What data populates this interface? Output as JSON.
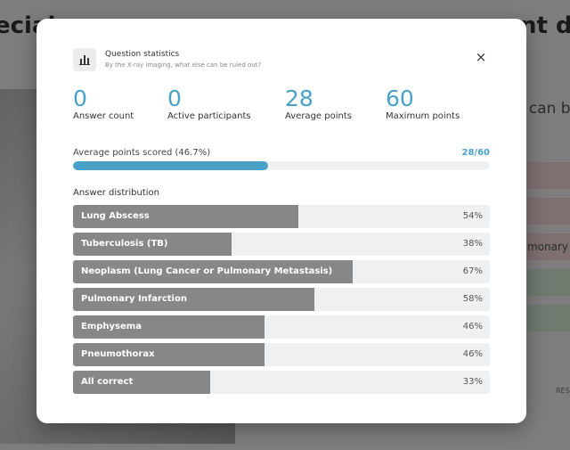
{
  "background": {
    "title_left": "ecial",
    "title_right": "nt d",
    "question_right": "e can b",
    "answer_fragment": "monary",
    "button_fragment": "RES",
    "answer_colors": [
      "#f3d6d6",
      "#f3d6d6",
      "#f3d6d6",
      "#d7ecd7",
      "#d7ecd7"
    ]
  },
  "modal": {
    "title": "Question statistics",
    "subtitle": "By the X-ray imaging, what else can be ruled out?",
    "close_label": "×",
    "icon": "bar-chart-icon",
    "accent_color": "#4aa1c8"
  },
  "stats": [
    {
      "value": "0",
      "label": "Answer count"
    },
    {
      "value": "0",
      "label": "Active participants"
    },
    {
      "value": "28",
      "label": "Average points"
    },
    {
      "value": "60",
      "label": "Maximum points"
    }
  ],
  "average": {
    "label": "Average points scored (46.7%)",
    "score": "28/60",
    "fraction": 0.467
  },
  "distribution": {
    "heading": "Answer distribution",
    "items": [
      {
        "label": "Lung Abscess",
        "percent": "54%",
        "value": 54
      },
      {
        "label": "Tuberculosis (TB)",
        "percent": "38%",
        "value": 38
      },
      {
        "label": "Neoplasm (Lung Cancer or Pulmonary Metastasis)",
        "percent": "67%",
        "value": 67
      },
      {
        "label": "Pulmonary Infarction",
        "percent": "58%",
        "value": 58
      },
      {
        "label": "Emphysema",
        "percent": "46%",
        "value": 46
      },
      {
        "label": "Pneumothorax",
        "percent": "46%",
        "value": 46
      },
      {
        "label": "All correct",
        "percent": "33%",
        "value": 33
      }
    ]
  }
}
